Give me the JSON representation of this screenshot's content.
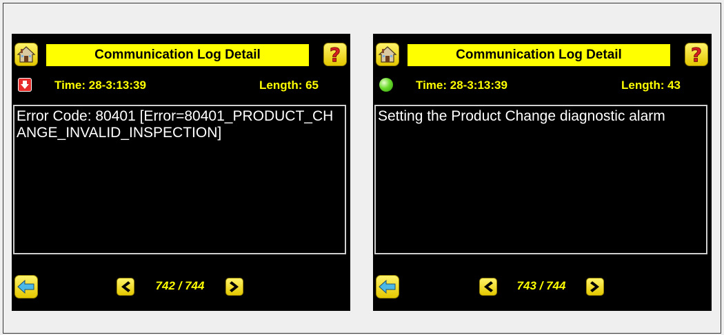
{
  "screens": [
    {
      "title": "Communication Log Detail",
      "status": "error",
      "status_icon": "error-arrow-icon",
      "time": "Time: 28-3:13:39",
      "length": "Length: 65",
      "message": "Error Code: 80401 [Error=80401_PRODUCT_CHANGE_INVALID_INSPECTION]",
      "page": "742 / 744"
    },
    {
      "title": "Communication Log Detail",
      "status": "ok",
      "status_icon": "green-status-icon",
      "time": "Time: 28-3:13:39",
      "length": "Length: 43",
      "message": "Setting the Product Change diagnostic alarm",
      "page": "743 / 744"
    }
  ],
  "colors": {
    "accent_yellow": "#ffff00",
    "screen_bg": "#000000",
    "error_red": "#e82c2c",
    "ok_green": "#6cdb2c"
  }
}
